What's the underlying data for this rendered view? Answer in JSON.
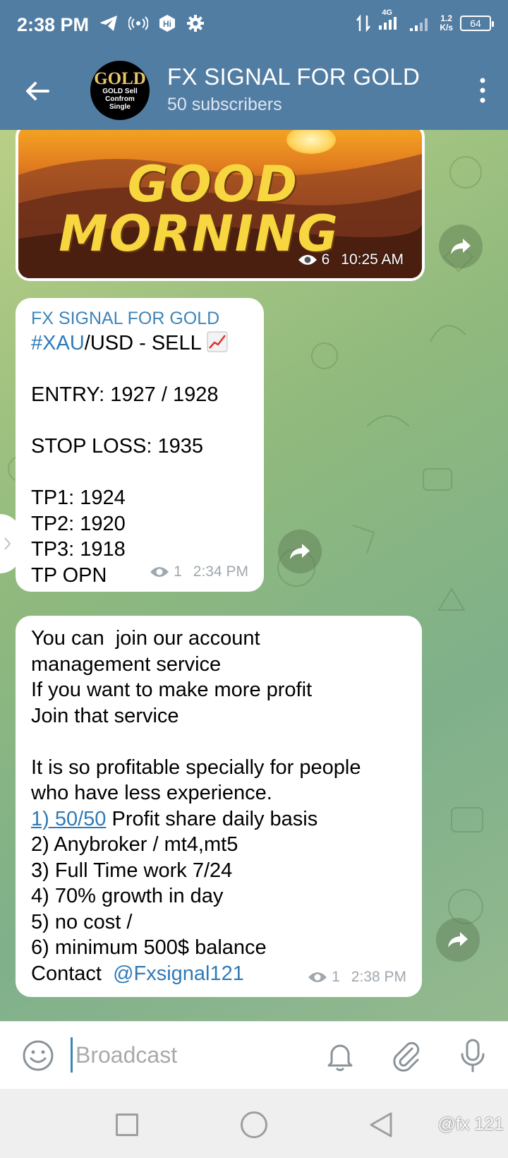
{
  "status_bar": {
    "time": "2:38 PM",
    "network_label": "4G",
    "net_speed_value": "1.2",
    "net_speed_unit": "K/s",
    "battery": "64"
  },
  "header": {
    "title": "FX SIGNAL FOR GOLD",
    "subscribers": "50 subscribers",
    "avatar_text_main": "GOLD",
    "avatar_text_lines": [
      "GOLD Sell",
      "Confrom",
      "Single"
    ]
  },
  "messages": {
    "image_post": {
      "image_text_line1": "GOOD",
      "image_text_line2": "MORNING",
      "views": "6",
      "time": "10:25 AM"
    },
    "signal_post": {
      "sender": "FX SIGNAL FOR GOLD",
      "hashtag": "#XAU",
      "pair_rest": "/USD - SELL",
      "entry": "ENTRY: 1927 / 1928",
      "stop_loss": "STOP LOSS: 1935",
      "tp1": "TP1: 1924",
      "tp2": "TP2: 1920",
      "tp3": "TP3: 1918",
      "tp_open": "TP OPN",
      "views": "1",
      "time": "2:34 PM"
    },
    "service_post": {
      "line1": "You can  join our account",
      "line2": "management service",
      "line3": "If you want to make more profit",
      "line4": "Join that service",
      "line5": "It is so profitable specially for people",
      "line6": "who have less experience.",
      "item1_link": "1) 50/50",
      "item1_rest": " Profit share daily basis",
      "item2": "2) Anybroker / mt4,mt5",
      "item3": "3) Full Time work 7/24",
      "item4": "4) 70% growth in day",
      "item5": "5) no cost /",
      "item6": "6) minimum 500$ balance",
      "contact_label": "Contact  ",
      "contact_handle": "@Fxsignal121",
      "views": "1",
      "time": "2:38 PM"
    }
  },
  "input_bar": {
    "placeholder": "Broadcast"
  },
  "watermark": "@fx 121",
  "icons": {
    "back": "arrow-left-icon",
    "menu": "more-vertical-icon",
    "share": "share-arrow-icon",
    "views": "eye-icon",
    "emoji": "emoji-icon",
    "bell": "bell-icon",
    "attach": "paperclip-icon",
    "mic": "microphone-icon"
  },
  "colors": {
    "header_bg": "#527da3",
    "link": "#2f7ab8",
    "sender": "#3f85b8"
  }
}
